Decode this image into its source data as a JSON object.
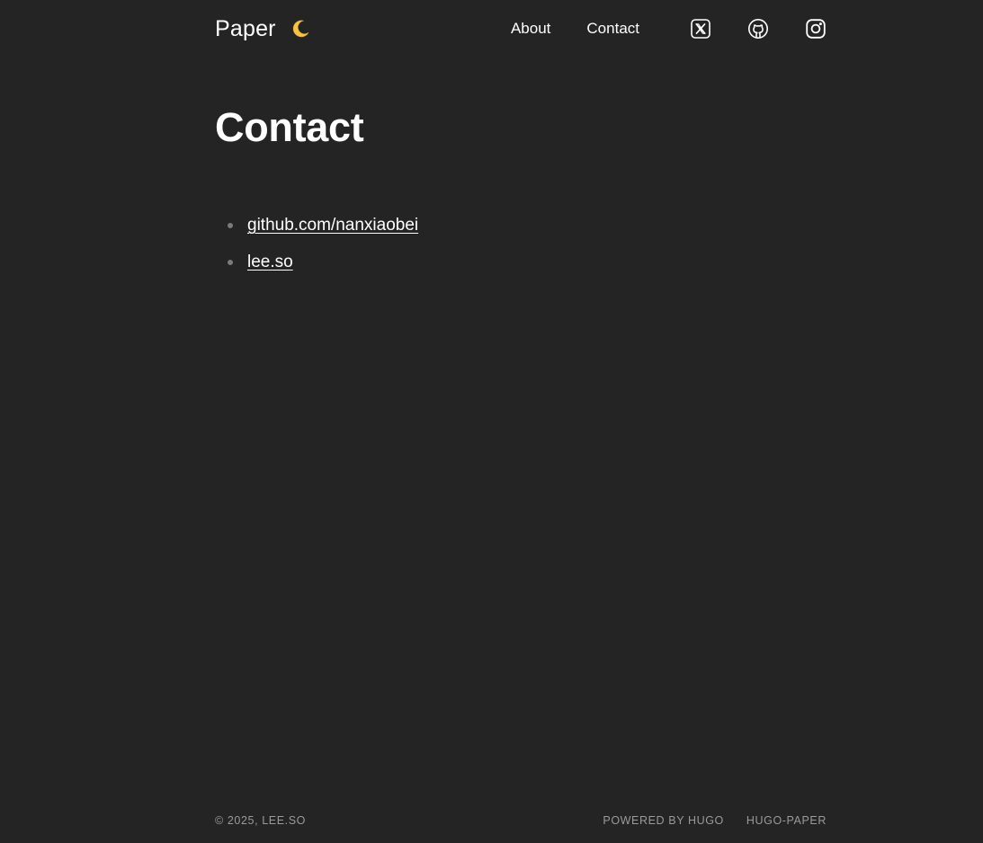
{
  "header": {
    "site_title": "Paper",
    "theme_toggle_icon": "moon-icon",
    "nav": [
      {
        "label": "About"
      },
      {
        "label": "Contact"
      }
    ],
    "socials": [
      {
        "icon": "x-twitter-icon"
      },
      {
        "icon": "github-icon"
      },
      {
        "icon": "instagram-icon"
      }
    ]
  },
  "main": {
    "title": "Contact",
    "links": [
      {
        "label": "github.com/nanxiaobei"
      },
      {
        "label": "lee.so"
      }
    ]
  },
  "footer": {
    "copyright": "© 2025, LEE.SO",
    "powered_by": "POWERED BY HUGO",
    "theme": "HUGO-PAPER"
  },
  "colors": {
    "background": "#242424",
    "text": "#ffffff",
    "muted": "#9a9a9a",
    "moon": "#f5c542"
  }
}
